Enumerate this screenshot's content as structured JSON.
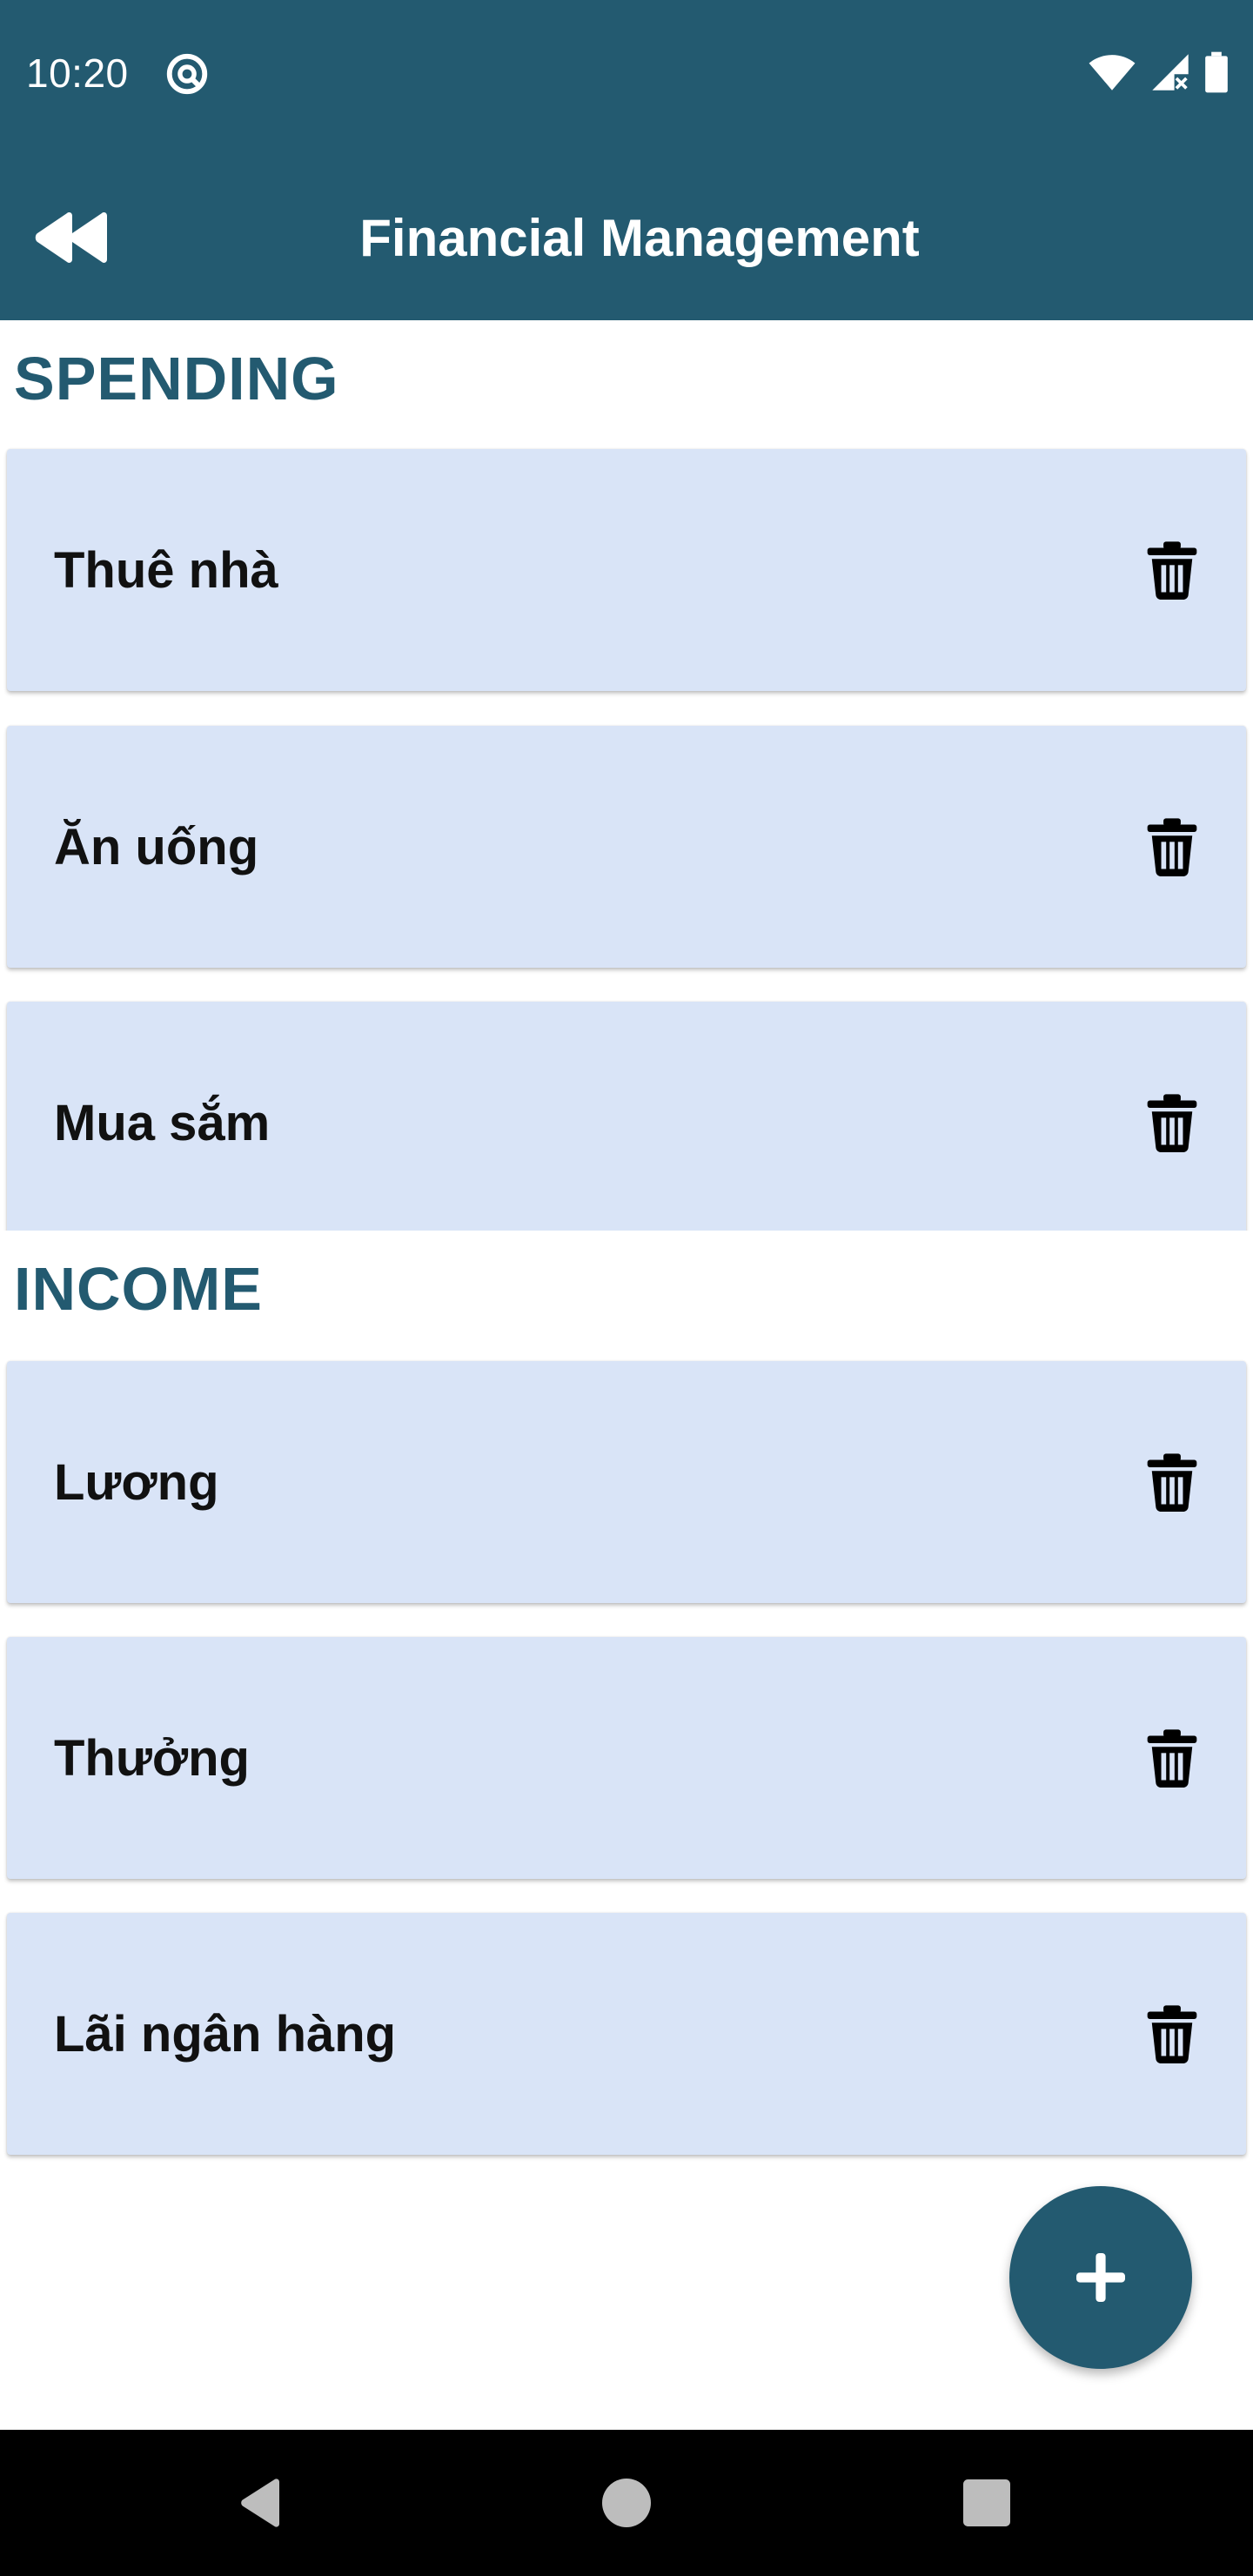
{
  "status_bar": {
    "time": "10:20"
  },
  "toolbar": {
    "title": "Financial Management",
    "back_icon": "fast-rewind-icon"
  },
  "sections": {
    "spending": {
      "title": "SPENDING",
      "items": [
        {
          "label": "Thuê nhà"
        },
        {
          "label": "Ăn uống"
        },
        {
          "label": "Mua sắm"
        }
      ]
    },
    "income": {
      "title": "INCOME",
      "items": [
        {
          "label": "Lương"
        },
        {
          "label": "Thưởng"
        },
        {
          "label": "Lãi ngân hàng"
        }
      ]
    }
  },
  "fab": {
    "icon": "plus-icon"
  },
  "colors": {
    "primary": "#235a70",
    "card_background": "#d9e4f7",
    "text": "#111111",
    "navigation_bar": "#000000"
  }
}
